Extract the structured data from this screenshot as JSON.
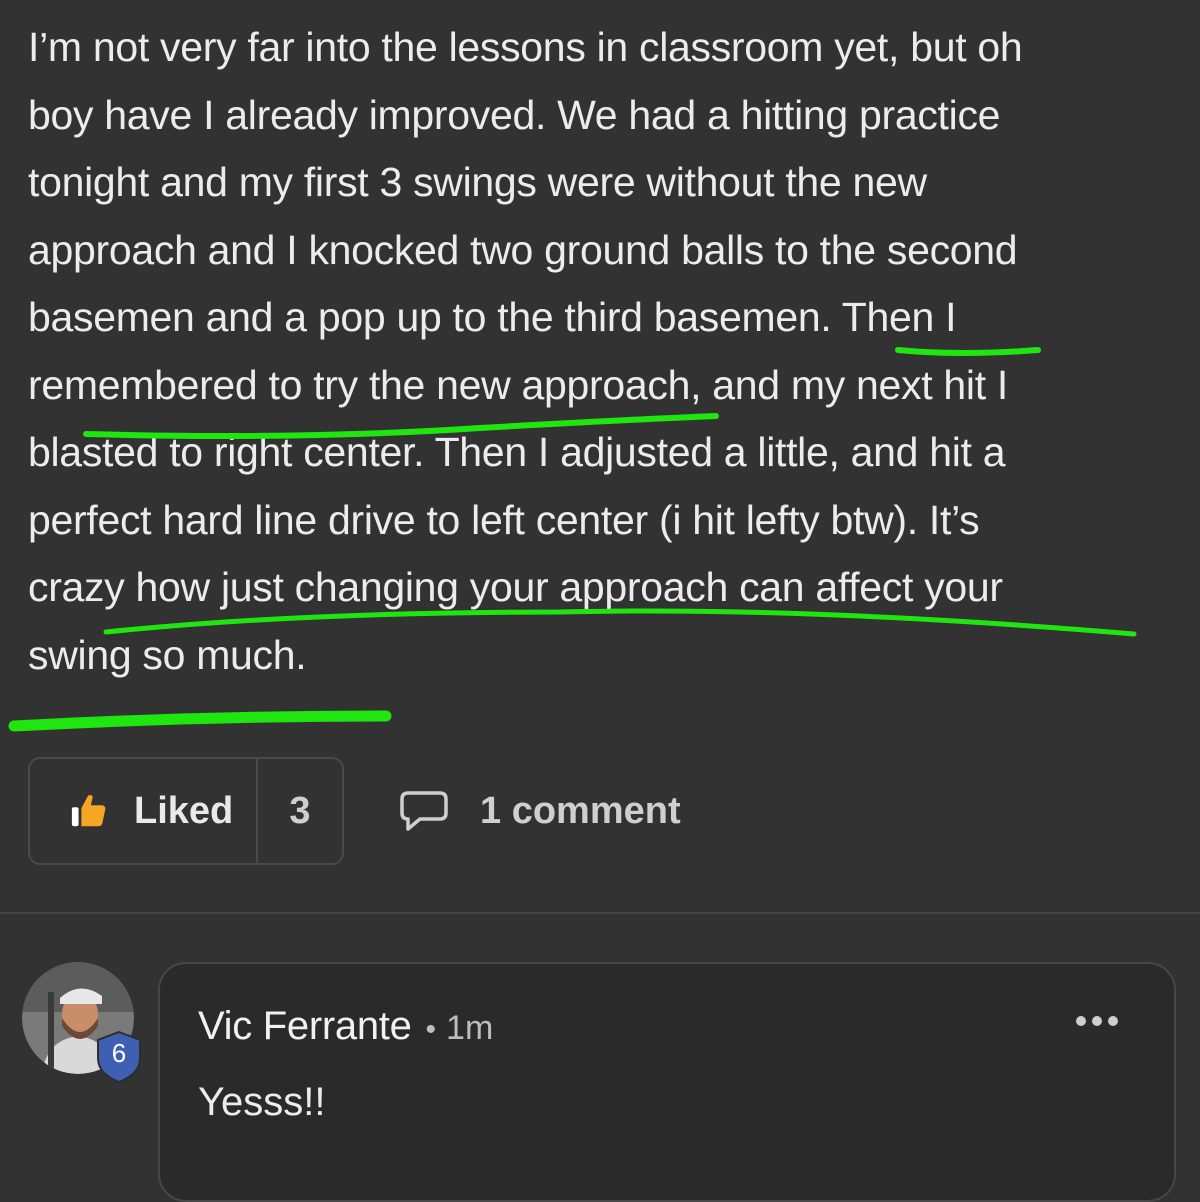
{
  "post": {
    "lines": [
      "I’m not very far into the lessons in classroom yet, but oh",
      "boy have I already improved. We had a hitting practice",
      "tonight and my first 3 swings were without the new",
      "approach and I knocked two ground balls to the second",
      "basemen and a pop up to the third basemen. Then I",
      "remembered to try the new approach, and my next hit I",
      "blasted to right center. Then I adjusted a little, and hit a",
      "perfect hard line drive to left center (i hit lefty btw). It’s",
      "crazy how just changing your approach can affect your",
      "swing so much."
    ],
    "annotation_color": "#1fe60f"
  },
  "actions": {
    "like_label": "Liked",
    "like_count": "3",
    "comment_label": "1 comment",
    "like_icon": "thumbs-up-icon",
    "comment_icon": "speech-bubble-icon",
    "like_icon_color": "#f5a623"
  },
  "comment": {
    "author": "Vic Ferrante",
    "separator": "•",
    "time": "1m",
    "text": "Yesss!!",
    "level": "6",
    "badge_color": "#3f5fb5"
  }
}
